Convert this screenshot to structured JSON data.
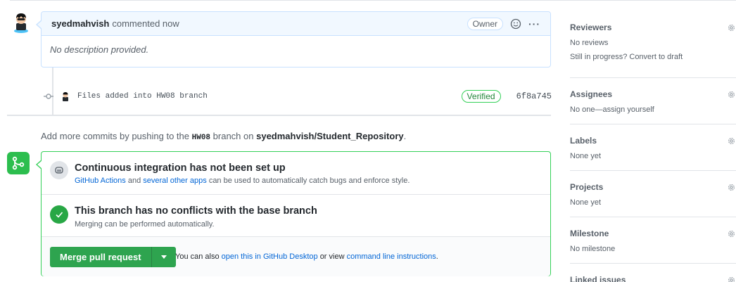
{
  "comment": {
    "author": "syedmahvish",
    "action": "commented now",
    "badge": "Owner",
    "more": "···",
    "body": "No description provided."
  },
  "commit": {
    "message": "Files added into HW08 branch",
    "verified": "Verified",
    "sha": "6f8a745"
  },
  "add_commits": {
    "prefix": "Add more commits by pushing to the",
    "branch": "HW08",
    "middle": "branch on",
    "repo": "syedmahvish/Student_Repository",
    "suffix": "."
  },
  "ci": {
    "title": "Continuous integration has not been set up",
    "link1": "GitHub Actions",
    "and": "and",
    "link2": "several other apps",
    "rest": "can be used to automatically catch bugs and enforce style."
  },
  "conflicts": {
    "title": "This branch has no conflicts with the base branch",
    "desc": "Merging can be performed automatically."
  },
  "merge": {
    "button": "Merge pull request",
    "note_prefix": "You can also",
    "link1": "open this in GitHub Desktop",
    "note_middle": "or view",
    "link2": "command line instructions",
    "note_suffix": "."
  },
  "sidebar": {
    "reviewers": {
      "title": "Reviewers",
      "line1": "No reviews",
      "line2": "Still in progress? Convert to draft"
    },
    "assignees": {
      "title": "Assignees",
      "line1": "No one—assign yourself"
    },
    "labels": {
      "title": "Labels",
      "line1": "None yet"
    },
    "projects": {
      "title": "Projects",
      "line1": "None yet"
    },
    "milestone": {
      "title": "Milestone",
      "line1": "No milestone"
    },
    "linked": {
      "title": "Linked issues"
    }
  },
  "colors": {
    "accent_link": "#0366d6",
    "success_green": "#28a745",
    "comment_header_bg": "#f1f8ff"
  }
}
